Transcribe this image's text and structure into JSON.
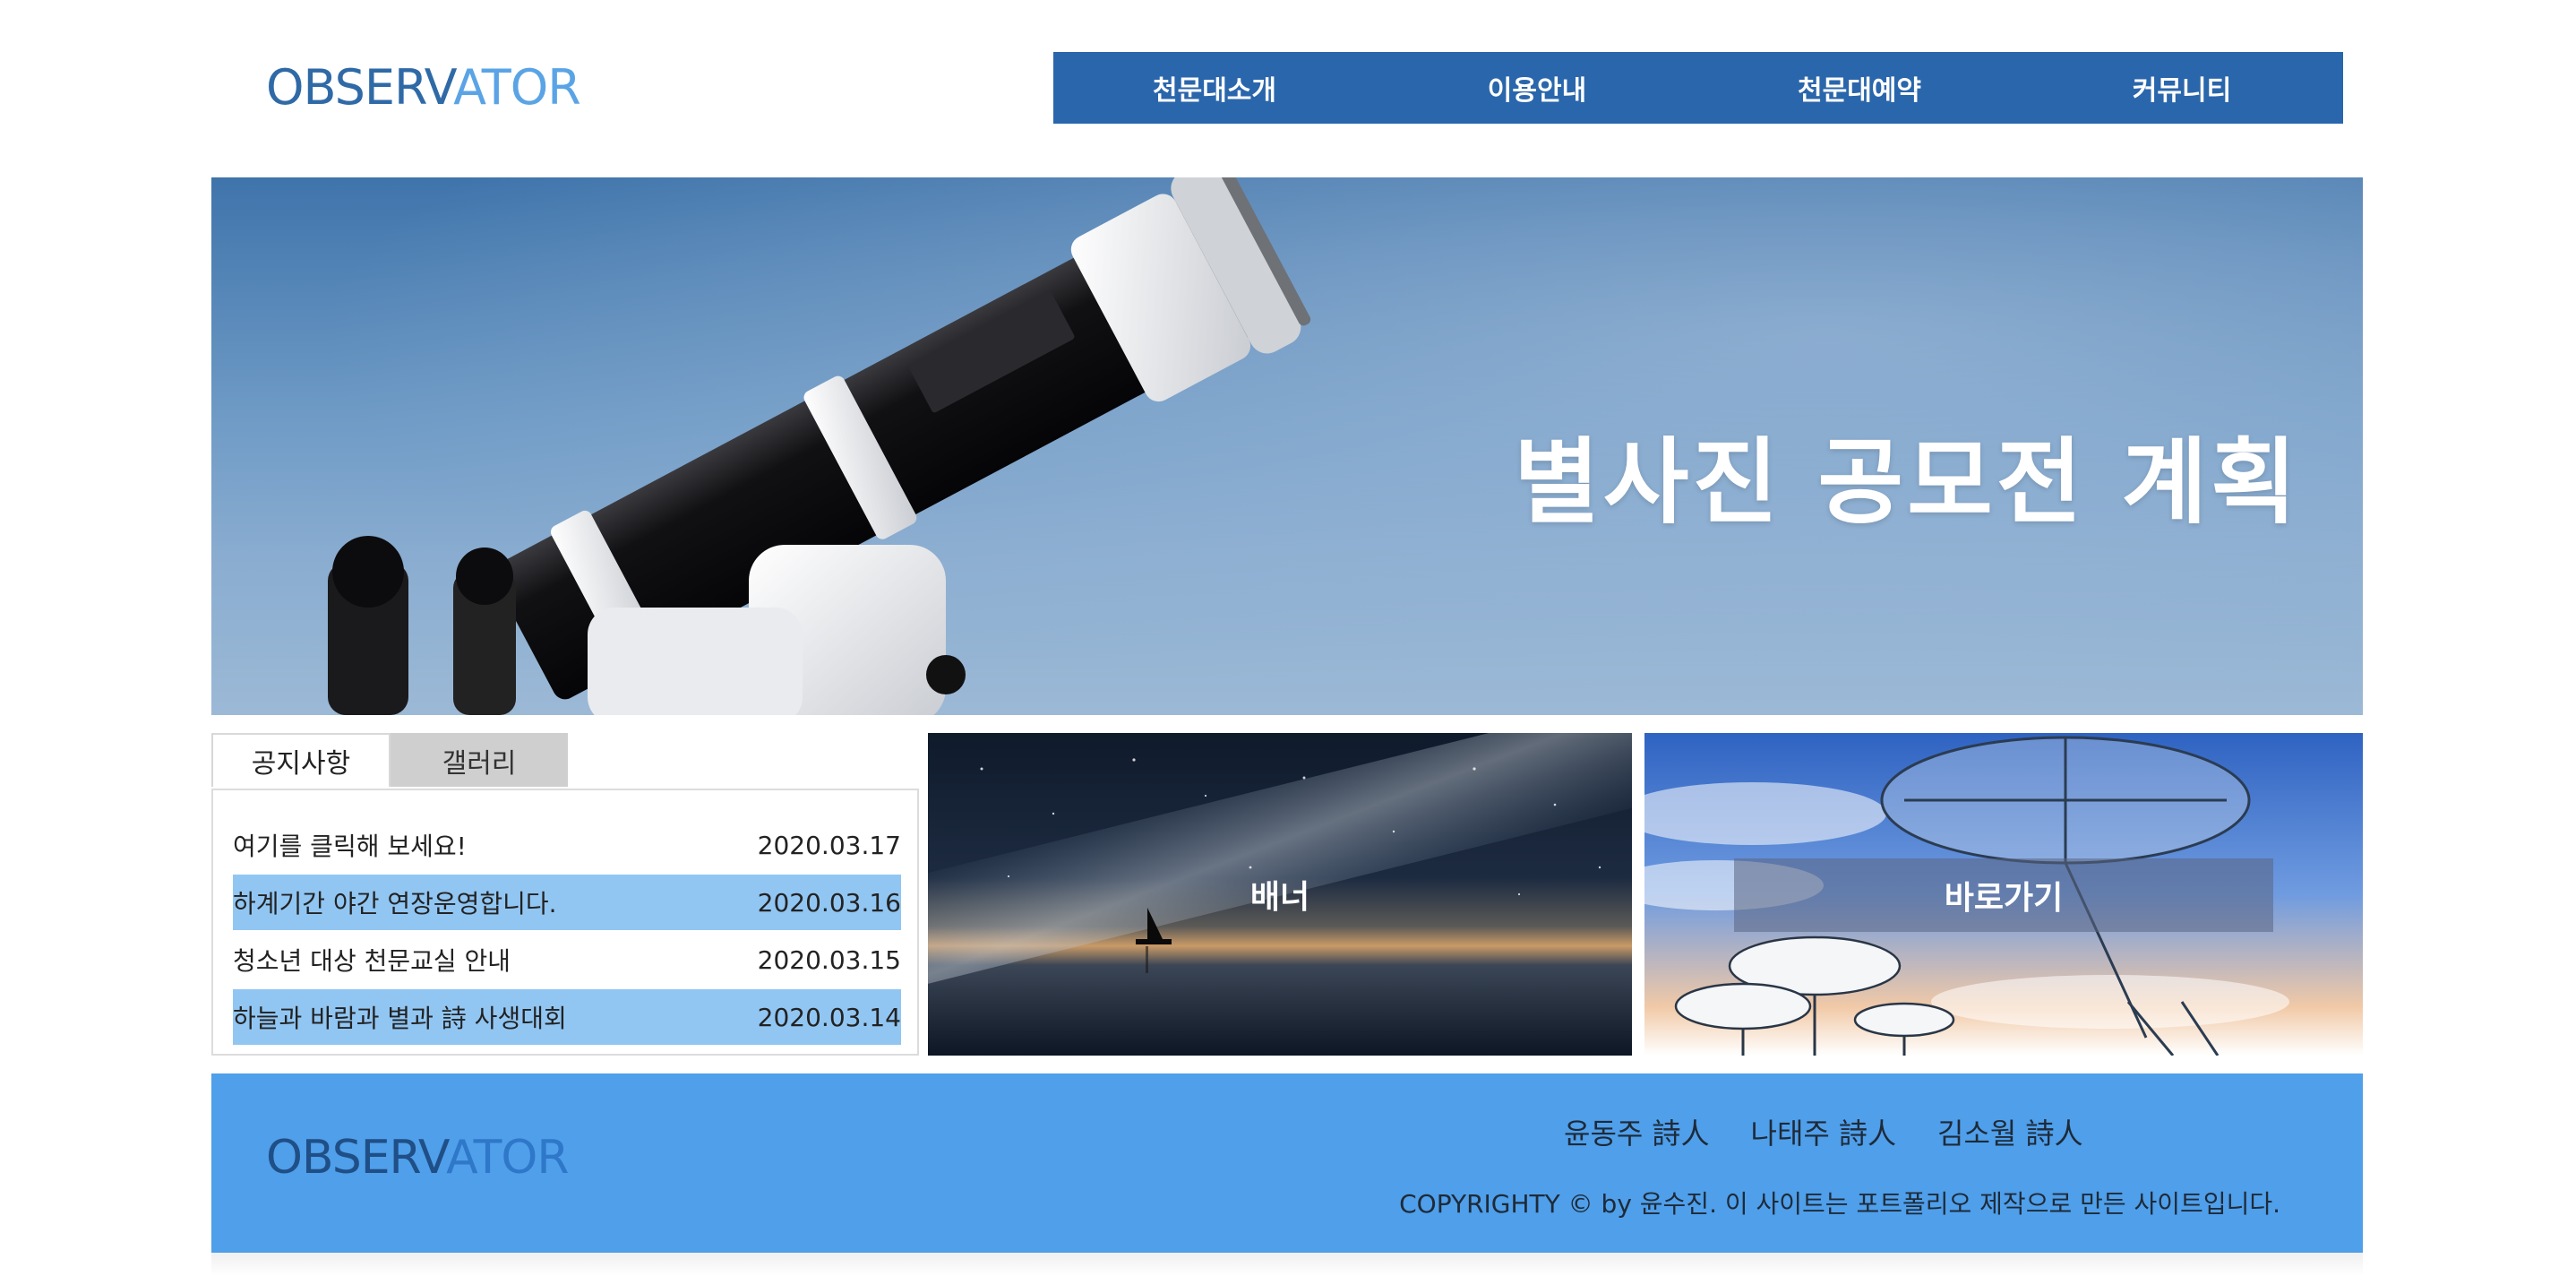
{
  "header": {
    "logo_a": "OBSERV",
    "logo_b": "ATOR",
    "nav": [
      {
        "label": "천문대소개"
      },
      {
        "label": "이용안내"
      },
      {
        "label": "천문대예약"
      },
      {
        "label": "커뮤니티"
      }
    ]
  },
  "hero": {
    "title": "별사진 공모전 계획"
  },
  "tabs": {
    "items": [
      {
        "label": "공지사항",
        "active": true
      },
      {
        "label": "갤러리",
        "active": false
      }
    ],
    "notices": [
      {
        "title": "여기를 클릭해 보세요!",
        "date": "2020.03.17",
        "highlight": false
      },
      {
        "title": "하계기간 야간 연장운영합니다.",
        "date": "2020.03.16",
        "highlight": true
      },
      {
        "title": "청소년 대상 천문교실 안내",
        "date": "2020.03.15",
        "highlight": false
      },
      {
        "title": "하늘과 바람과 별과 詩 사생대회",
        "date": "2020.03.14",
        "highlight": true
      }
    ]
  },
  "banners": {
    "banner1_label": "배너",
    "banner2_label": "바로가기"
  },
  "footer": {
    "logo_a": "OBSERV",
    "logo_b": "ATOR",
    "poets": [
      "윤동주 詩人",
      "나태주 詩人",
      "김소월 詩人"
    ],
    "copyright": "COPYRIGHTY © by 윤수진. 이 사이트는 포트폴리오 제작으로 만든 사이트입니다."
  },
  "colors": {
    "nav_bg": "#2a66ab",
    "highlight_row": "#91c6f3",
    "footer_bg": "#4f9fea",
    "logo": "#2f6aa7"
  },
  "icons": {
    "hero_image": "telescope-image",
    "banner1_image": "milky-way-sailboat-image",
    "banner2_image": "radio-telescope-dishes-image"
  }
}
